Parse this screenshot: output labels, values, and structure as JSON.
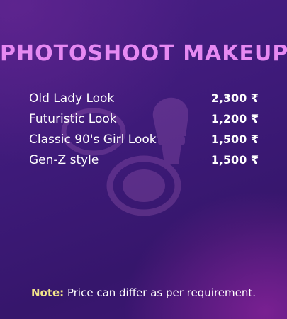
{
  "header": {
    "title": "PHOTOSHOOT MAKEUP"
  },
  "price_list": [
    {
      "name": "Old Lady Look",
      "price": "2,300 ₹"
    },
    {
      "name": "Futuristic Look",
      "price": "1,200 ₹"
    },
    {
      "name": "Classic 90's Girl Look",
      "price": "1,500 ₹"
    },
    {
      "name": "Gen-Z style",
      "price": "1,500 ₹"
    }
  ],
  "footer": {
    "note_label": "Note:",
    "note_text": " Price can differ as per requirement."
  },
  "icons": {
    "background": "makeup-compact-and-brush-icon"
  },
  "colors": {
    "title": "#e689f2",
    "note_label": "#f2e48a",
    "text": "#ffffff",
    "background": "#3d1a78",
    "glow": "#aa28aa"
  }
}
